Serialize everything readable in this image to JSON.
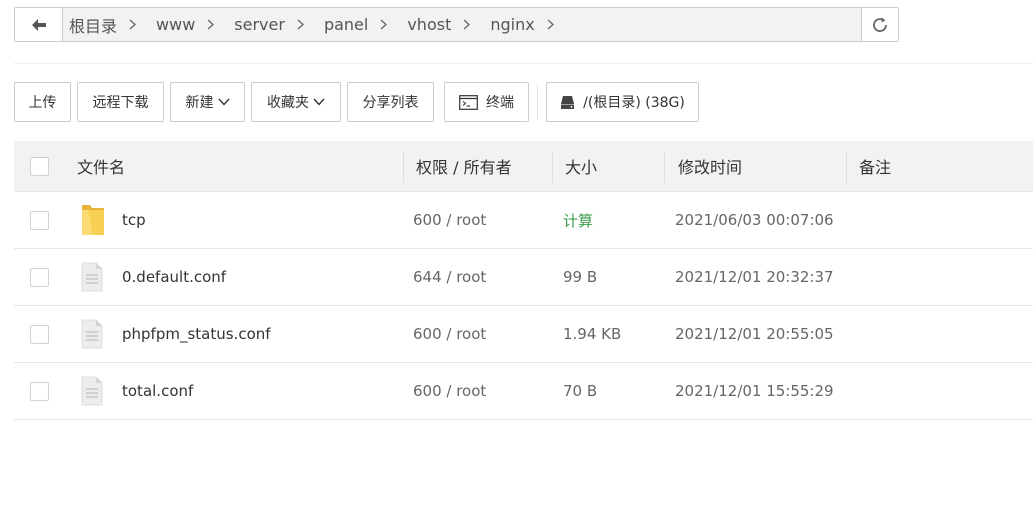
{
  "path": {
    "crumbs": [
      "根目录",
      "www",
      "server",
      "panel",
      "vhost",
      "nginx"
    ]
  },
  "toolbar": {
    "upload": "上传",
    "remote_download": "远程下载",
    "new": "新建",
    "favorites": "收藏夹",
    "share_list": "分享列表",
    "terminal": "终端",
    "disk": "/(根目录) (38G)"
  },
  "table": {
    "headers": {
      "name": "文件名",
      "perm": "权限 / 所有者",
      "size": "大小",
      "mtime": "修改时间",
      "note": "备注"
    },
    "rows": [
      {
        "type": "folder",
        "name": "tcp",
        "perm": "600 / root",
        "size": "计算",
        "mtime": "2021/06/03 00:07:06"
      },
      {
        "type": "file",
        "name": "0.default.conf",
        "perm": "644 / root",
        "size": "99 B",
        "mtime": "2021/12/01 20:32:37"
      },
      {
        "type": "file",
        "name": "phpfpm_status.conf",
        "perm": "600 / root",
        "size": "1.94 KB",
        "mtime": "2021/12/01 20:55:05"
      },
      {
        "type": "file",
        "name": "total.conf",
        "perm": "600 / root",
        "size": "70 B",
        "mtime": "2021/12/01 15:55:29"
      }
    ]
  },
  "colors": {
    "link_green": "#3e9d4e",
    "folder_yellow": "#f5c842"
  }
}
